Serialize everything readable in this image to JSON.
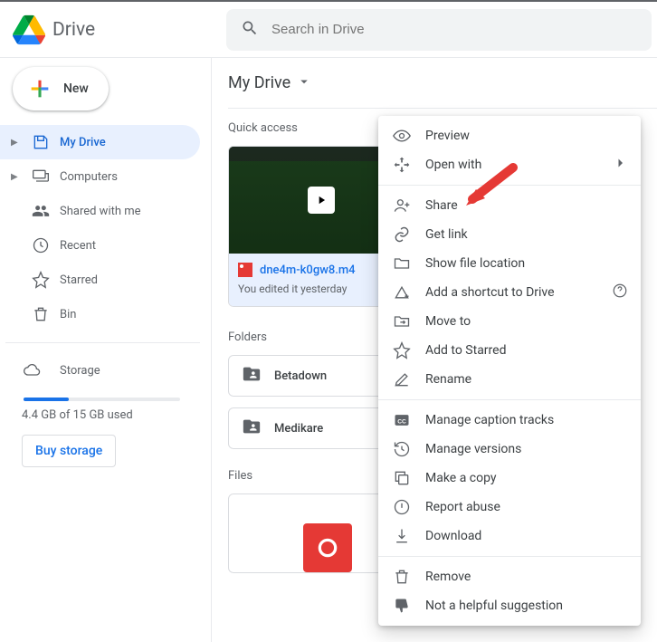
{
  "header": {
    "app_name": "Drive",
    "search_placeholder": "Search in Drive"
  },
  "new_button": {
    "label": "New"
  },
  "sidebar": {
    "items": [
      {
        "label": "My Drive"
      },
      {
        "label": "Computers"
      },
      {
        "label": "Shared with me"
      },
      {
        "label": "Recent"
      },
      {
        "label": "Starred"
      },
      {
        "label": "Bin"
      }
    ],
    "storage_label": "Storage",
    "storage_used": "4.4 GB of 15 GB used",
    "storage_percent": 29,
    "buy_storage": "Buy storage"
  },
  "main": {
    "breadcrumb": "My Drive",
    "quick_label": "Quick access",
    "quick_item": {
      "filename": "dne4m-k0gw8.m4",
      "subtitle": "You edited it yesterday"
    },
    "folders_label": "Folders",
    "folders": [
      {
        "name": "Betadown"
      },
      {
        "name": "Medikare"
      }
    ],
    "files_label": "Files"
  },
  "context_menu": {
    "items": [
      {
        "label": "Preview"
      },
      {
        "label": "Open with"
      },
      {
        "label": "Share"
      },
      {
        "label": "Get link"
      },
      {
        "label": "Show file location"
      },
      {
        "label": "Add a shortcut to Drive"
      },
      {
        "label": "Move to"
      },
      {
        "label": "Add to Starred"
      },
      {
        "label": "Rename"
      },
      {
        "label": "Manage caption tracks"
      },
      {
        "label": "Manage versions"
      },
      {
        "label": "Make a copy"
      },
      {
        "label": "Report abuse"
      },
      {
        "label": "Download"
      },
      {
        "label": "Remove"
      },
      {
        "label": "Not a helpful suggestion"
      }
    ]
  }
}
